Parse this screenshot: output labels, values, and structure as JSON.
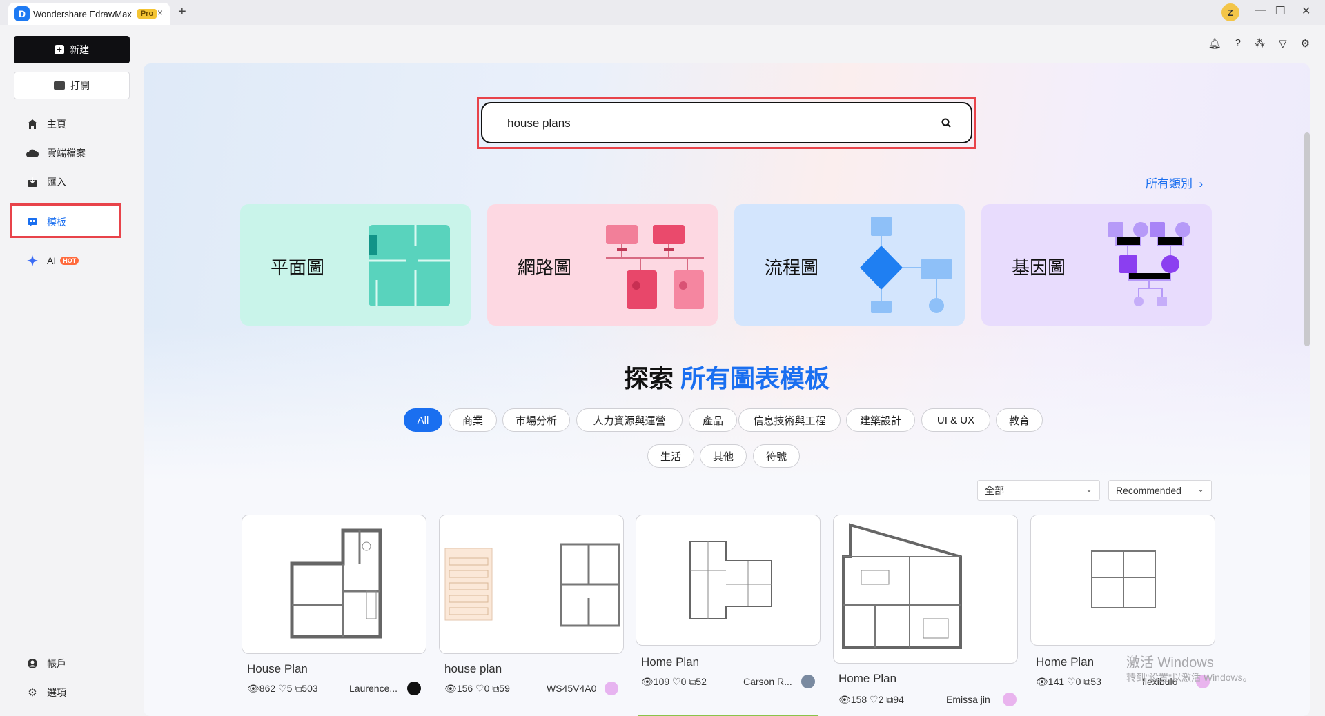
{
  "titlebar": {
    "app_title": "Wondershare EdrawMax",
    "badge": "Pro",
    "close_tab": "×",
    "add_tab": "+",
    "user_initial": "Z",
    "minimize": "—",
    "restore": "❐",
    "close": "✕"
  },
  "sidebar": {
    "new_label": "新建",
    "open_label": "打開",
    "items": [
      {
        "label": "主頁",
        "icon": "home-icon"
      },
      {
        "label": "雲端檔案",
        "icon": "cloud-icon"
      },
      {
        "label": "匯入",
        "icon": "import-icon"
      },
      {
        "label": "模板",
        "icon": "template-icon"
      },
      {
        "label": "AI",
        "icon": "sparkle-icon",
        "badge": "HOT"
      }
    ],
    "bottom": [
      {
        "label": "帳戶",
        "icon": "account-icon"
      },
      {
        "label": "選項",
        "icon": "gear-icon"
      }
    ]
  },
  "search": {
    "value": "house plans",
    "placeholder": ""
  },
  "all_categories": "所有類別",
  "categories": [
    {
      "label": "平面圖",
      "color": "#c9f4ea"
    },
    {
      "label": "網路圖",
      "color": "#fdd8e2"
    },
    {
      "label": "流程圖",
      "color": "#d3e5fd"
    },
    {
      "label": "基因圖",
      "color": "#e8dcfd"
    }
  ],
  "explore": {
    "prefix": "探索",
    "highlight": "所有圖表模板"
  },
  "filters_row1": [
    "All",
    "商業",
    "市場分析",
    "人力資源與運營",
    "產品",
    "信息技術與工程",
    "建築設計",
    "UI & UX",
    "教育"
  ],
  "filters_row2": [
    "生活",
    "其他",
    "符號"
  ],
  "selects": {
    "scope": "全部",
    "sort": "Recommended"
  },
  "templates": [
    {
      "title": "House Plan",
      "views": "862",
      "likes": "5",
      "copies": "503",
      "author": "Laurence..."
    },
    {
      "title": "house plan",
      "views": "156",
      "likes": "0",
      "copies": "59",
      "author": "WS45V4A0"
    },
    {
      "title": "Home Plan",
      "views": "109",
      "likes": "0",
      "copies": "52",
      "author": "Carson R..."
    },
    {
      "title": "Home Plan",
      "views": "158",
      "likes": "2",
      "copies": "94",
      "author": "Emissa jin"
    },
    {
      "title": "Home Plan",
      "views": "141",
      "likes": "0",
      "copies": "53",
      "author": "flexibul6"
    }
  ],
  "watermark": {
    "line1": "激活 Windows",
    "line2": "转到\"设置\"以激活 Windows。"
  },
  "colors": {
    "accent": "#1a6ff0",
    "highlight_border": "#e8434a"
  }
}
